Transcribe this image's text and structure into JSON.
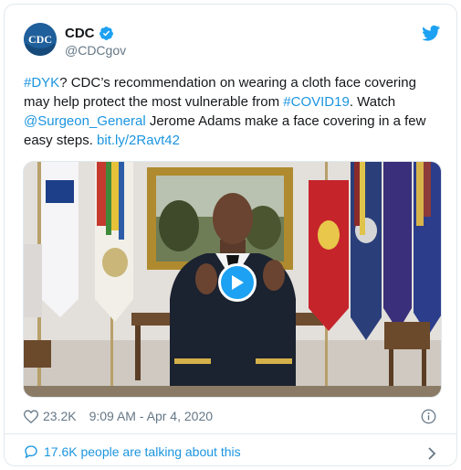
{
  "author": {
    "name": "CDC",
    "handle": "@CDCgov",
    "avatar_text": "CDC"
  },
  "tweet": {
    "hashtag1": "#DYK",
    "text1": "? CDC’s recommendation on wearing a cloth face covering may help protect the most vulnerable from ",
    "hashtag2": "#COVID19",
    "text2": ". Watch ",
    "mention": "@Surgeon_General",
    "text3": " Jerome Adams make a face covering in a few easy steps. ",
    "url": "bit.ly/2Ravt42"
  },
  "meta": {
    "likes": "23.2K",
    "timestamp": "9:09 AM - Apr 4, 2020"
  },
  "footer": {
    "talking": "17.6K people are talking about this"
  },
  "colors": {
    "link": "#1b95e0",
    "brand_blue": "#1da1f2",
    "muted": "#657786"
  },
  "icons": [
    "verified-badge-icon",
    "twitter-bird-icon",
    "play-icon",
    "heart-icon",
    "info-icon",
    "comment-icon",
    "chevron-right-icon"
  ]
}
